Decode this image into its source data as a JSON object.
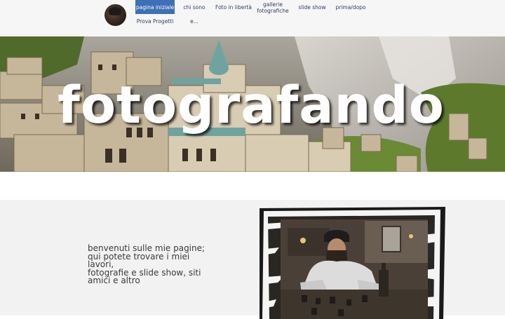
{
  "nav": {
    "items": [
      {
        "label": "pagina iniziale",
        "active": true
      },
      {
        "label": "chi sono",
        "active": false
      },
      {
        "label": "Foto in libertà",
        "active": false
      },
      {
        "label": "gallerie fotografiche",
        "active": false
      },
      {
        "label": "slide show",
        "active": false
      },
      {
        "label": "prima/dopo",
        "active": false
      },
      {
        "label": "Prova Progetti",
        "active": false
      },
      {
        "label": "e...",
        "active": false
      }
    ],
    "active_color": "#3f6fb5"
  },
  "hero": {
    "title": "fotografando"
  },
  "welcome": {
    "lines": [
      "benvenuti sulle mie pagine;",
      "qui potete trovare i miei",
      "lavori,",
      "fotografie e slide show, siti",
      "amici e altro"
    ]
  },
  "icons": {
    "logo": "avatar-photo",
    "hero_image": "nativity-village-photo",
    "content_image": "pirate-at-table-photo"
  }
}
